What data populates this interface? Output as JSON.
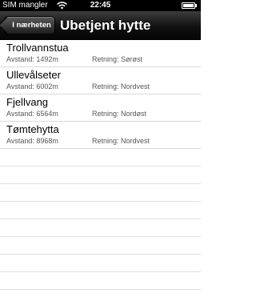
{
  "status_bar": {
    "carrier": "SIM mangler",
    "time": "22:45"
  },
  "nav": {
    "back_label": "I nærheten",
    "title": "Ubetjent hytte"
  },
  "cabins": [
    {
      "name": "Trollvannstua",
      "distance": "Avstand: 1492m",
      "direction": "Retning: Sørøst"
    },
    {
      "name": "Ullevålseter",
      "distance": "Avstand: 6002m",
      "direction": "Retning: Nordvest"
    },
    {
      "name": "Fjellvang",
      "distance": "Avstand: 6564m",
      "direction": "Retning: Nordøst"
    },
    {
      "name": "Tømtehytta",
      "distance": "Avstand: 8968m",
      "direction": "Retning: Nordvest"
    }
  ],
  "icons": {
    "wifi": "wifi-icon",
    "battery": "battery-icon",
    "back": "back-chevron"
  }
}
